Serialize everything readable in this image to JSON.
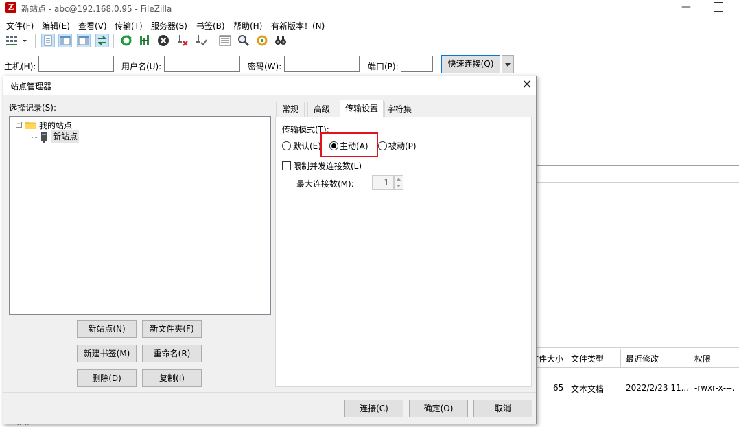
{
  "window": {
    "title": "新站点 - abc@192.168.0.95 - FileZilla",
    "logo": "Z",
    "minimize": "—"
  },
  "menu": [
    "文件(F)",
    "编辑(E)",
    "查看(V)",
    "传输(T)",
    "服务器(S)",
    "书签(B)",
    "帮助(H)",
    "有新版本！(N)"
  ],
  "toolbar_icons": [
    "site-manager-icon",
    "dropdown-arrow-icon",
    "toggle-message-log-icon",
    "toggle-local-tree-icon",
    "toggle-remote-tree-icon",
    "toggle-transfer-queue-icon",
    "refresh-icon",
    "process-queue-icon",
    "cancel-icon",
    "disconnect-icon",
    "reconnect-icon",
    "directory-filter-icon",
    "compare-directories-icon",
    "sync-browsing-icon",
    "search-remote-icon"
  ],
  "quickconnect": {
    "host_label": "主机(H):",
    "user_label": "用户名(U):",
    "pass_label": "密码(W):",
    "port_label": "端口(P):",
    "connect_button": "快速连接(Q)"
  },
  "background": {
    "remote_columns": [
      "文件大小",
      "文件类型",
      "最近修改",
      "权限"
    ],
    "remote_row": {
      "size": "65",
      "type": "文本文档",
      "modified": "2022/2/23 11...",
      "perms": "-rwxr-x---."
    },
    "bottom_row_fragment": "wrk"
  },
  "dialog": {
    "title": "站点管理器",
    "close": "✕",
    "tree_label": "选择记录(S):",
    "tree": {
      "root": "我的站点",
      "expander": "−",
      "child": "新站点"
    },
    "buttons": {
      "new_site": "新站点(N)",
      "new_folder": "新文件夹(F)",
      "new_bookmark": "新建书签(M)",
      "rename": "重命名(R)",
      "delete": "删除(D)",
      "copy": "复制(I)"
    },
    "tabs": [
      "常规",
      "高级",
      "传输设置",
      "字符集"
    ],
    "active_tab": "传输设置",
    "transfer": {
      "mode_label": "传输模式(T):",
      "options": [
        {
          "label": "默认(E)",
          "checked": false
        },
        {
          "label": "主动(A)",
          "checked": true
        },
        {
          "label": "被动(P)",
          "checked": false
        }
      ],
      "limit_label": "限制并发连接数(L)",
      "limit_checked": false,
      "max_label": "最大连接数(M):",
      "max_value": "1"
    },
    "footer": {
      "connect": "连接(C)",
      "ok": "确定(O)",
      "cancel": "取消"
    },
    "highlight_color": "#e0141a"
  }
}
